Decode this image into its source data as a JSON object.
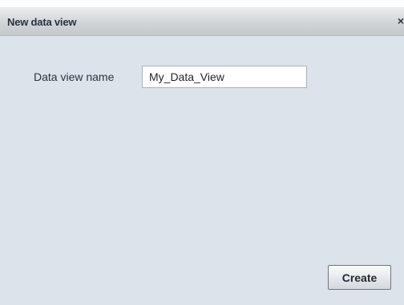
{
  "dialog": {
    "title": "New data view",
    "close_glyph": "×",
    "close_icon": "close-icon"
  },
  "form": {
    "name_label": "Data view name",
    "name_value": "My_Data_View"
  },
  "actions": {
    "create_label": "Create"
  },
  "colors": {
    "dialog_background": "#dce3ea",
    "titlebar_text": "#26323e"
  }
}
